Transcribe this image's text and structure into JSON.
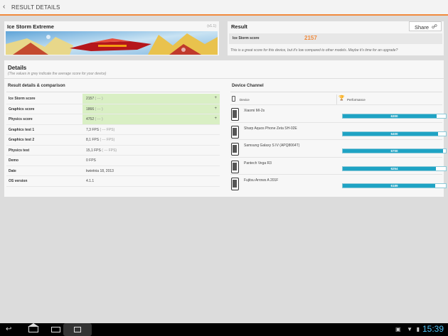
{
  "topbar": {
    "title": "RESULT DETAILS"
  },
  "benchmark": {
    "name": "Ice Storm Extreme",
    "version": "(v1.1)"
  },
  "result": {
    "label": "Result",
    "share_label": "Share",
    "score_label": "Ice Storm score",
    "score_value": "2157",
    "note": "This is a great score for this device, but it's low compared to other models. Maybe it's time for an upgrade?"
  },
  "details": {
    "title": "Details",
    "subtitle": "(The values in grey indicate the average score for your device)",
    "comparison_title": "Result details & comparison",
    "rows": [
      {
        "key": "Ice Storm score",
        "value": "2157",
        "avg": "( --- )",
        "highlight": true
      },
      {
        "key": "Graphics score",
        "value": "1866",
        "avg": "( --- )",
        "highlight": true
      },
      {
        "key": "Physics score",
        "value": "4752",
        "avg": "( --- )",
        "highlight": true
      },
      {
        "key": "Graphics test 1",
        "value": "7,3 FPS",
        "avg": "( --- FPS)",
        "highlight": false
      },
      {
        "key": "Graphics test 2",
        "value": "8,1 FPS",
        "avg": "( --- FPS)",
        "highlight": false
      },
      {
        "key": "Physics test",
        "value": "15,1 FPS",
        "avg": "( --- FPS)",
        "highlight": false
      },
      {
        "key": "Demo",
        "value": "0 FPS",
        "avg": "",
        "highlight": false
      },
      {
        "key": "Date",
        "value": "kwietnia 18, 2013",
        "avg": "",
        "highlight": false
      },
      {
        "key": "OS version",
        "value": "4.1.1",
        "avg": "",
        "highlight": false
      }
    ]
  },
  "device_channel": {
    "title": "Device Channel",
    "device_col": "Device",
    "perf_col": "Performance",
    "max_score": 6900,
    "devices": [
      {
        "name": "Xiaomi MI-2s",
        "score": 6300
      },
      {
        "name": "Sharp Aquos Phone Zeta SH-02E",
        "score": 6400
      },
      {
        "name": "Samsung Galaxy S IV (APQ8064T)",
        "score": 6700
      },
      {
        "name": "Pantech Vega R3",
        "score": 6254
      },
      {
        "name": "Fujitsu Arrows A 201F",
        "score": 6189
      }
    ]
  },
  "statusbar": {
    "time": "15:39"
  },
  "colors": {
    "accent": "#f08a3c",
    "bar": "#1fa3c4",
    "highlight": "#d9efc4",
    "clock": "#4fc3f7"
  }
}
